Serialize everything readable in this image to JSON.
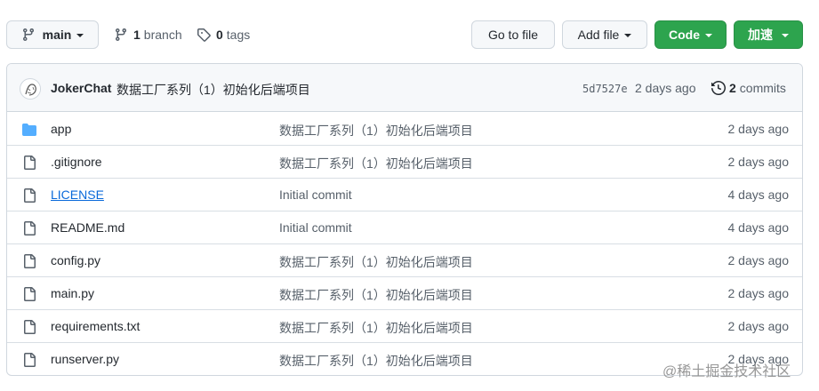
{
  "toolbar": {
    "branch_label": "main",
    "branches_count": "1",
    "branches_label": "branch",
    "tags_count": "0",
    "tags_label": "tags",
    "goto_label": "Go to file",
    "addfile_label": "Add file",
    "code_label": "Code",
    "speed_label": "加速"
  },
  "commit": {
    "author": "JokerChat",
    "message": "数据工厂系列（1）初始化后端项目",
    "sha": "5d7527e",
    "time": "2 days ago",
    "commits_count": "2",
    "commits_label": "commits"
  },
  "files": [
    {
      "name": "app",
      "type": "folder",
      "message": "数据工厂系列（1）初始化后端项目",
      "time": "2 days ago"
    },
    {
      "name": ".gitignore",
      "type": "file",
      "message": "数据工厂系列（1）初始化后端项目",
      "time": "2 days ago"
    },
    {
      "name": "LICENSE",
      "type": "file",
      "message": "Initial commit",
      "time": "4 days ago"
    },
    {
      "name": "README.md",
      "type": "file",
      "message": "Initial commit",
      "time": "4 days ago"
    },
    {
      "name": "config.py",
      "type": "file",
      "message": "数据工厂系列（1）初始化后端项目",
      "time": "2 days ago"
    },
    {
      "name": "main.py",
      "type": "file",
      "message": "数据工厂系列（1）初始化后端项目",
      "time": "2 days ago"
    },
    {
      "name": "requirements.txt",
      "type": "file",
      "message": "数据工厂系列（1）初始化后端项目",
      "time": "2 days ago"
    },
    {
      "name": "runserver.py",
      "type": "file",
      "message": "数据工厂系列（1）初始化后端项目",
      "time": "2 days ago"
    }
  ],
  "watermark": "@稀土掘金技术社区",
  "colors": {
    "accent_green": "#2da44e",
    "folder_blue": "#54aeff",
    "link_blue": "#0969da"
  },
  "icons": {
    "branch": "git-branch-icon",
    "tag": "tag-icon",
    "history": "history-icon",
    "folder": "folder-icon",
    "file": "file-icon"
  }
}
